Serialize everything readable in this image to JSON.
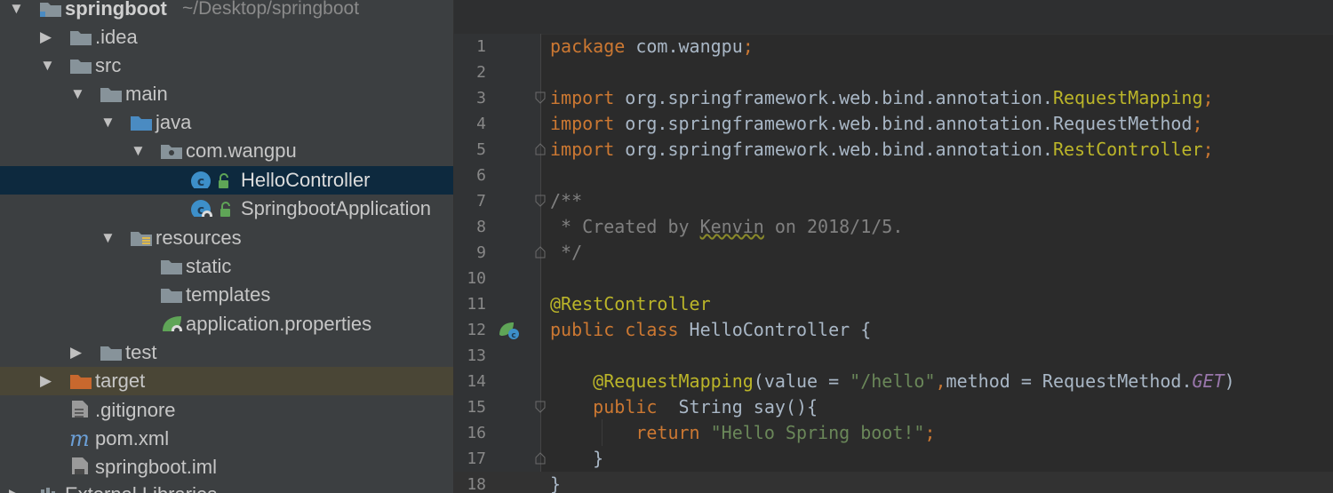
{
  "project_tree": {
    "items": [
      {
        "label": "springboot",
        "path": "~/Desktop/springboot",
        "expanded": true
      },
      {
        "label": ".idea",
        "expanded": false
      },
      {
        "label": "src",
        "expanded": true
      },
      {
        "label": "main",
        "expanded": true
      },
      {
        "label": "java",
        "expanded": true
      },
      {
        "label": "com.wangpu",
        "expanded": true
      },
      {
        "label": "HelloController",
        "selected": true
      },
      {
        "label": "SpringbootApplication"
      },
      {
        "label": "resources",
        "expanded": true
      },
      {
        "label": "static"
      },
      {
        "label": "templates"
      },
      {
        "label": "application.properties"
      },
      {
        "label": "test",
        "expanded": false
      },
      {
        "label": "target",
        "expanded": false
      },
      {
        "label": ".gitignore"
      },
      {
        "label": "pom.xml"
      },
      {
        "label": "springboot.iml"
      },
      {
        "label": "External Libraries"
      }
    ]
  },
  "editor": {
    "line_numbers": [
      "1",
      "2",
      "3",
      "4",
      "5",
      "6",
      "7",
      "8",
      "9",
      "10",
      "11",
      "12",
      "13",
      "14",
      "15",
      "16",
      "17",
      "18"
    ],
    "current_line": "18",
    "lines": [
      [
        {
          "t": "kw",
          "v": "package "
        },
        {
          "t": "plain",
          "v": "com.wangpu"
        },
        {
          "t": "kw",
          "v": ";"
        }
      ],
      [],
      [
        {
          "t": "kw",
          "v": "import "
        },
        {
          "t": "plain",
          "v": "org.springframework.web.bind.annotation."
        },
        {
          "t": "annot",
          "v": "RequestMapping"
        },
        {
          "t": "kw",
          "v": ";"
        }
      ],
      [
        {
          "t": "kw",
          "v": "import "
        },
        {
          "t": "plain",
          "v": "org.springframework.web.bind.annotation."
        },
        {
          "t": "plain",
          "v": "RequestMethod"
        },
        {
          "t": "kw",
          "v": ";"
        }
      ],
      [
        {
          "t": "kw",
          "v": "import "
        },
        {
          "t": "plain",
          "v": "org.springframework.web.bind.annotation."
        },
        {
          "t": "annot",
          "v": "RestController"
        },
        {
          "t": "kw",
          "v": ";"
        }
      ],
      [],
      [
        {
          "t": "cmt",
          "v": "/**"
        }
      ],
      [
        {
          "t": "cmt",
          "v": " * Created by "
        },
        {
          "t": "cmt typo",
          "v": "Kenvin"
        },
        {
          "t": "cmt",
          "v": " on 2018/1/5."
        }
      ],
      [
        {
          "t": "cmt",
          "v": " */"
        }
      ],
      [],
      [
        {
          "t": "annot",
          "v": "@RestController"
        }
      ],
      [
        {
          "t": "kw",
          "v": "public class "
        },
        {
          "t": "plain",
          "v": "HelloController {"
        }
      ],
      [],
      [
        {
          "t": "plain",
          "v": "    "
        },
        {
          "t": "annot",
          "v": "@RequestMapping"
        },
        {
          "t": "plain",
          "v": "(value = "
        },
        {
          "t": "str",
          "v": "\"/hello\""
        },
        {
          "t": "kw",
          "v": ","
        },
        {
          "t": "plain",
          "v": "method = RequestMethod."
        },
        {
          "t": "ital",
          "v": "GET"
        },
        {
          "t": "plain",
          "v": ")"
        }
      ],
      [
        {
          "t": "plain",
          "v": "    "
        },
        {
          "t": "kw",
          "v": "public  "
        },
        {
          "t": "plain",
          "v": "String say(){"
        }
      ],
      [
        {
          "t": "plain",
          "v": "        "
        },
        {
          "t": "kw",
          "v": "return "
        },
        {
          "t": "str",
          "v": "\"Hello Spring boot!\""
        },
        {
          "t": "kw",
          "v": ";"
        }
      ],
      [
        {
          "t": "plain",
          "v": "    }"
        }
      ],
      [
        {
          "t": "plain",
          "v": "}"
        }
      ]
    ]
  },
  "colors": {
    "tree_bg": "#3c3f41",
    "tree_selected": "#0d293e",
    "editor_bg": "#2b2b2b",
    "gutter_bg": "#313335",
    "keyword": "#cc7832",
    "annotation": "#bbb529",
    "string": "#6a8759",
    "comment": "#808080",
    "folder": "#87939a",
    "excluded_folder": "#c8682e",
    "source_folder": "#4a8bc2",
    "class_icon": "#3d8fc9"
  },
  "icons": {
    "folder": "folder-icon",
    "package": "package-icon",
    "class": "class-c-icon",
    "spring_boot_app": "spring-boot-app-icon",
    "spring_properties": "spring-leaf-icon",
    "maven": "maven-icon",
    "file": "file-icon"
  }
}
